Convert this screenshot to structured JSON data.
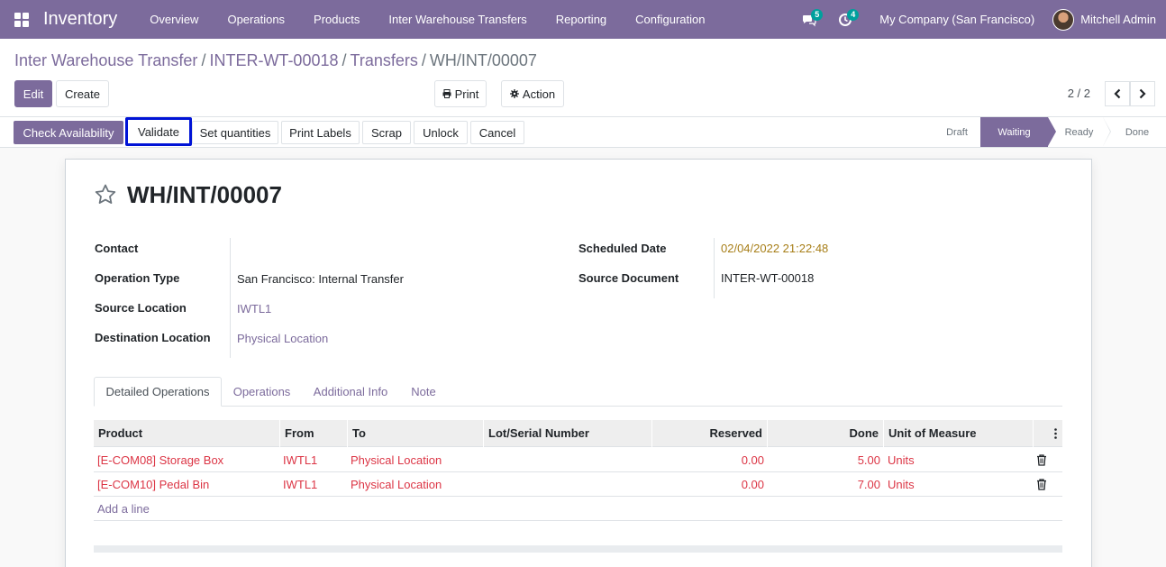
{
  "navbar": {
    "app_name": "Inventory",
    "menu": [
      "Overview",
      "Operations",
      "Products",
      "Inter Warehouse Transfers",
      "Reporting",
      "Configuration"
    ],
    "messages_count": "5",
    "activities_count": "4",
    "company": "My Company (San Francisco)",
    "user": "Mitchell Admin"
  },
  "breadcrumb": {
    "items": [
      "Inter Warehouse Transfer",
      "INTER-WT-00018",
      "Transfers"
    ],
    "current": "WH/INT/00007",
    "separator": "/"
  },
  "toolbar": {
    "edit": "Edit",
    "create": "Create",
    "print": "Print",
    "action": "Action"
  },
  "pager": {
    "value": "2 / 2"
  },
  "statusbar": {
    "buttons": [
      "Check Availability",
      "Validate",
      "Set quantities",
      "Print Labels",
      "Scrap",
      "Unlock",
      "Cancel"
    ],
    "stages": [
      "Draft",
      "Waiting",
      "Ready",
      "Done"
    ],
    "current_stage": "Waiting"
  },
  "record": {
    "title": "WH/INT/00007",
    "fields_left": [
      {
        "label": "Contact",
        "value": ""
      },
      {
        "label": "Operation Type",
        "value": "San Francisco: Internal Transfer"
      },
      {
        "label": "Source Location",
        "value": "IWTL1"
      },
      {
        "label": "Destination Location",
        "value": "Physical Location"
      }
    ],
    "fields_right": [
      {
        "label": "Scheduled Date",
        "value": "02/04/2022 21:22:48"
      },
      {
        "label": "Source Document",
        "value": "INTER-WT-00018"
      }
    ]
  },
  "tabs": [
    "Detailed Operations",
    "Operations",
    "Additional Info",
    "Note"
  ],
  "table": {
    "headers": [
      "Product",
      "From",
      "To",
      "Lot/Serial Number",
      "Reserved",
      "Done",
      "Unit of Measure"
    ],
    "rows": [
      {
        "product": "[E-COM08] Storage Box",
        "from": "IWTL1",
        "to": "Physical Location",
        "lot": "",
        "reserved": "0.00",
        "done": "5.00",
        "uom": "Units"
      },
      {
        "product": "[E-COM10] Pedal Bin",
        "from": "IWTL1",
        "to": "Physical Location",
        "lot": "",
        "reserved": "0.00",
        "done": "7.00",
        "uom": "Units"
      }
    ],
    "add_line": "Add a line"
  },
  "colors": {
    "brand": "#7c6b9c",
    "focus_outline": "#0013d6",
    "date_text": "#a77e17",
    "row_text": "#dc3545"
  }
}
